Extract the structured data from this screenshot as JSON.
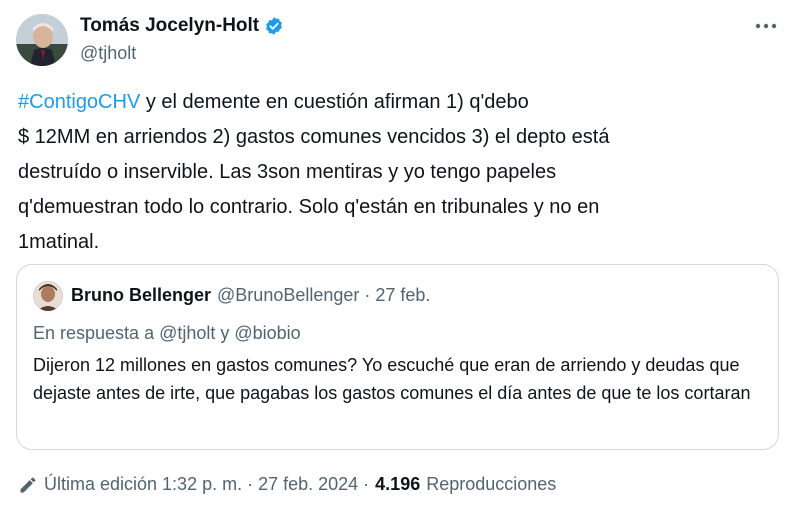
{
  "author": {
    "name": "Tomás Jocelyn-Holt",
    "handle": "@tjholt"
  },
  "tweet": {
    "hashtag": "#ContigoCHV",
    "text": " y el demente en cuestión afirman 1) q'debo\n$ 12MM en arriendos 2) gastos comunes vencidos 3) el depto está\ndestruído o inservible. Las 3son mentiras y yo tengo papeles\nq'demuestran todo lo contrario. Solo q'están en tribunales y no en\n1matinal."
  },
  "quote": {
    "name": "Bruno Bellenger",
    "meta": "@BrunoBellenger · 27 feb.",
    "reply_to": "En respuesta a @tjholt y @biobio",
    "text": "Dijeron 12 millones en gastos comunes? Yo escuché que eran de arriendo y deudas que dejaste antes de irte, que pagabas los gastos comunes el día antes de que te los cortaran"
  },
  "footer": {
    "edited": "Última edición 1:32 p. m. · 27 feb. 2024 ·",
    "views_count": "4.196",
    "views_label": "Reproducciones"
  },
  "colors": {
    "accent": "#1d9bf0",
    "muted": "#536471",
    "border": "#cfd9de"
  }
}
